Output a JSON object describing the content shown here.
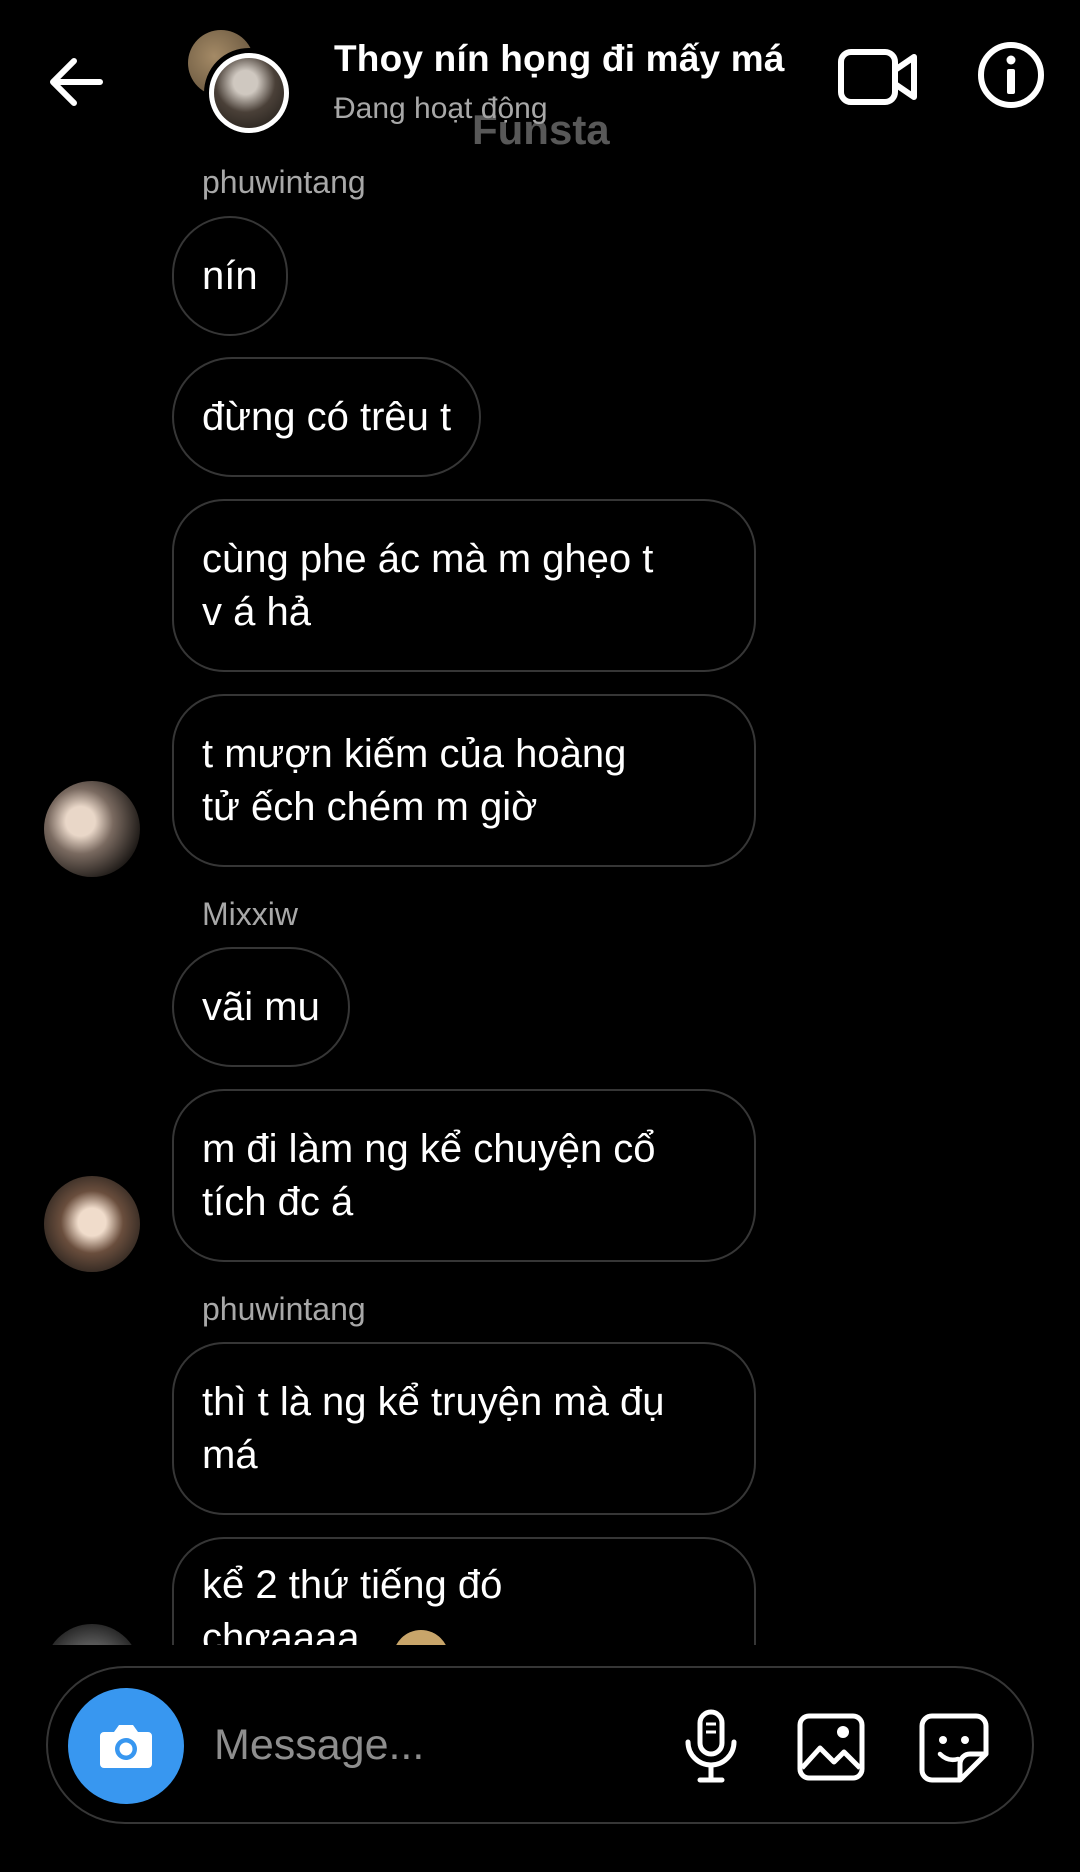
{
  "header": {
    "title": "Thoy nín họng đi mấy má",
    "status": "Đang hoạt động",
    "watermark": "Funsta"
  },
  "messages": [
    {
      "type": "sender",
      "text": "phuwintang"
    },
    {
      "type": "bubble",
      "lines": [
        "nín"
      ]
    },
    {
      "type": "bubble",
      "lines": [
        "đừng có trêu t"
      ]
    },
    {
      "type": "bubble",
      "lines": [
        "cùng phe ác mà m ghẹo t",
        "v á hả"
      ]
    },
    {
      "type": "bubble",
      "lines": [
        "t mượn kiếm của hoàng",
        "tử ếch chém m giờ"
      ]
    },
    {
      "type": "sender",
      "text": "Mixxiw"
    },
    {
      "type": "bubble",
      "lines": [
        "vãi mu"
      ]
    },
    {
      "type": "bubble",
      "lines": [
        "m đi làm ng kể chuyện cổ",
        "tích đc á"
      ]
    },
    {
      "type": "sender",
      "text": "phuwintang"
    },
    {
      "type": "bubble",
      "lines": [
        "thì t là ng kể truyện mà đụ",
        "má"
      ]
    },
    {
      "type": "bubble",
      "lines": [
        "kể 2 thứ tiếng đó",
        "chơaaaa"
      ]
    }
  ],
  "composer": {
    "placeholder": "Message..."
  },
  "icons": {
    "back": "arrow-left-icon",
    "video": "video-camera-icon",
    "info": "info-icon",
    "camera": "camera-icon",
    "mic": "microphone-icon",
    "gallery": "image-gallery-icon",
    "sticker": "sticker-icon"
  },
  "colors": {
    "background": "#000000",
    "bubble_border": "#363636",
    "secondary_text": "#a8a8a8",
    "camera_button": "#3897f0"
  }
}
